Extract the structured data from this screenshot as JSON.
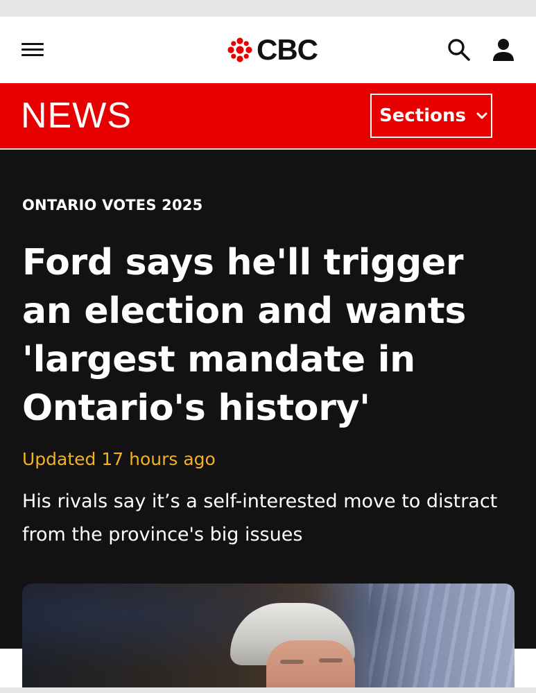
{
  "header": {
    "logo_text": "CBC",
    "icons": {
      "menu": "hamburger-menu-icon",
      "logo": "cbc-gem-logo",
      "search": "search-icon",
      "account": "user-account-icon"
    }
  },
  "newsbar": {
    "title": "NEWS",
    "sections_label": "Sections",
    "sections_icon": "chevron-down-icon"
  },
  "article": {
    "kicker": "ONTARIO VOTES 2025",
    "headline": "Ford says he'll trigger an election and wants 'largest mandate in Ontario's history'",
    "updated": "Updated 17 hours ago",
    "deck": "His rivals say it’s a self-interested move to distract from the province's big issues"
  },
  "colors": {
    "brand_red": "#e60000",
    "hero_bg": "#121212",
    "timestamp": "#f2b31f",
    "text_on_dark": "#ffffff",
    "header_bg": "#ffffff"
  }
}
